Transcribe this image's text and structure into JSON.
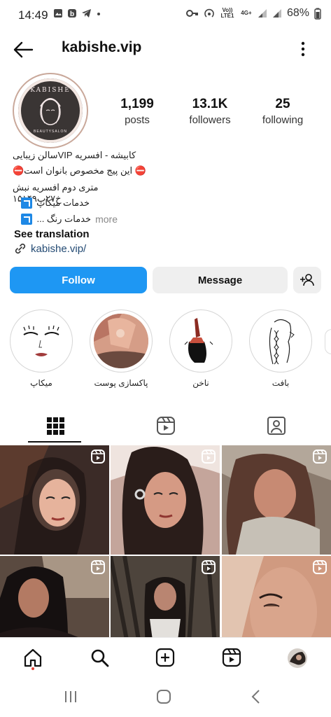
{
  "status": {
    "time": "14:49",
    "net_volte": "Vo)) LTE1",
    "net_4g": "4G+",
    "battery": "68%"
  },
  "header": {
    "username": "kabishe.vip"
  },
  "profile": {
    "logo_top": "KABISHE",
    "logo_bottom": "BEAUTYSALON",
    "stats": [
      {
        "value": "1,199",
        "label": "posts"
      },
      {
        "value": "13.1K",
        "label": "followers"
      },
      {
        "value": "25",
        "label": "following"
      }
    ]
  },
  "bio": {
    "line1": "کابیشه - افسریه VIPسالن زیبایی",
    "line2": "⛔ این پیج مخصوص بانوان است⛔",
    "line3": "متری دوم افسریه نبش خ۲۷پ۱۵۱۴۹",
    "line4": "خدمات میکاپ",
    "line5": "خدمات رنگ ...",
    "more": "more",
    "see_translation": "See translation",
    "link": "kabishe.vip/"
  },
  "buttons": {
    "follow": "Follow",
    "message": "Message"
  },
  "highlights": [
    {
      "label": "میکاپ"
    },
    {
      "label": "پاکسازی پوست"
    },
    {
      "label": "ناخن"
    },
    {
      "label": "بافت"
    }
  ],
  "colors": {
    "follow_blue": "#1e97f3",
    "notification_dot": "#e24034"
  }
}
